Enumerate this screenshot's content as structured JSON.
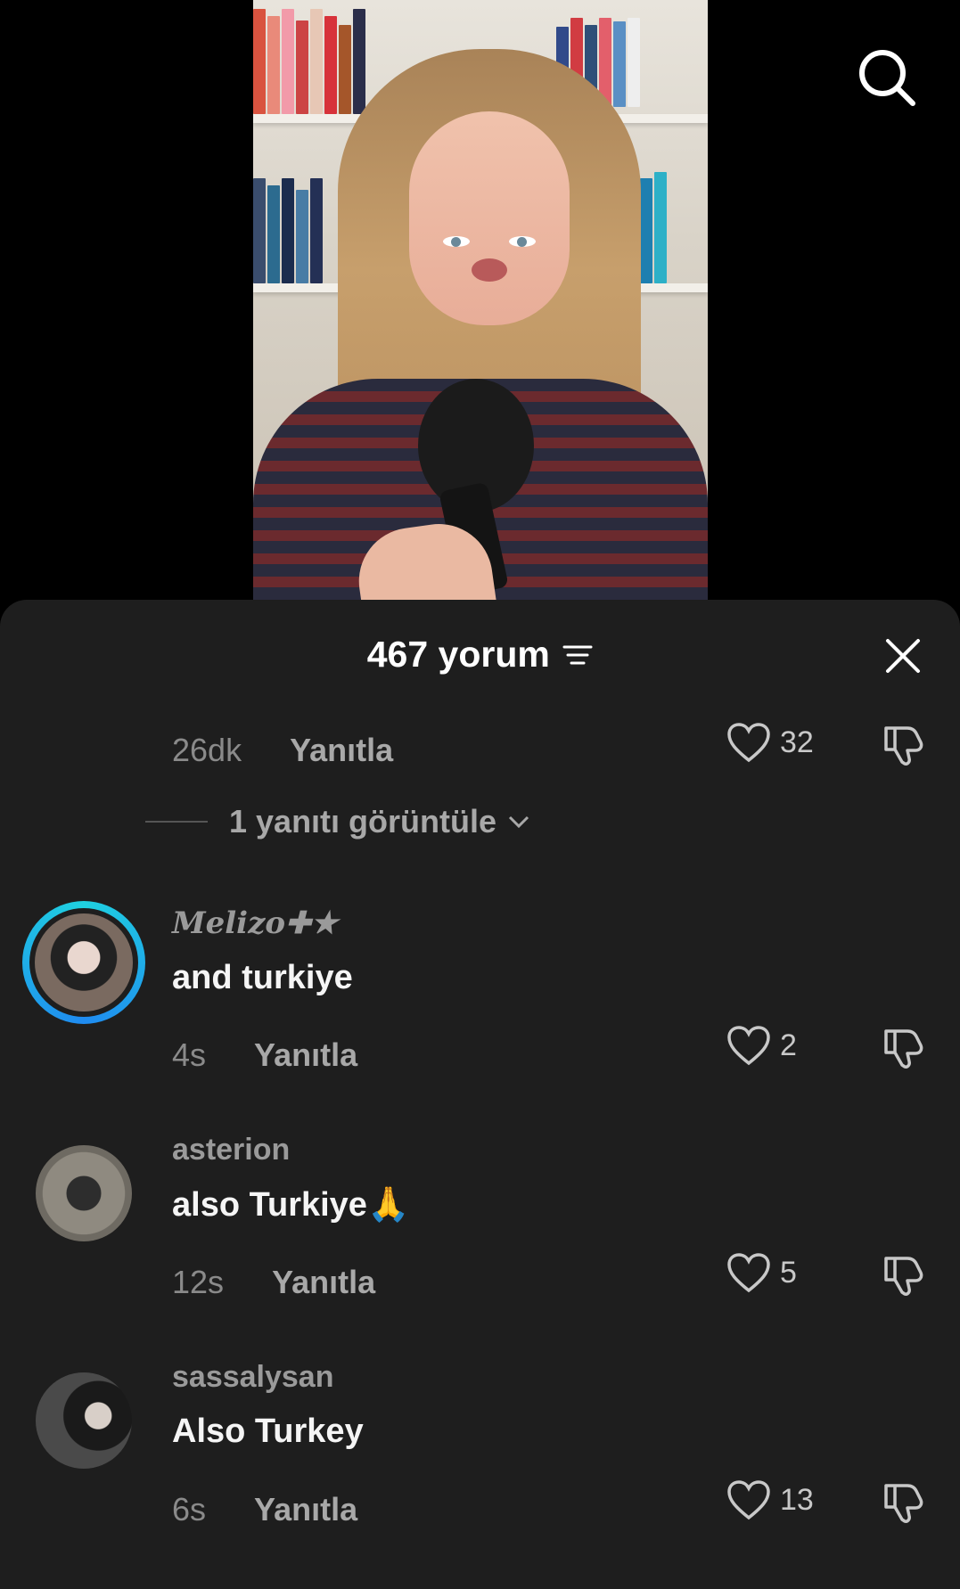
{
  "header": {
    "comment_count": "467 yorum"
  },
  "first_comment_tail": {
    "time": "26dk",
    "reply_label": "Yanıtla",
    "likes": "32"
  },
  "view_replies_label": "1 yanıtı görüntüle",
  "comments": [
    {
      "username": "Melizo✚★",
      "text": "and turkiye",
      "time": "4s",
      "reply_label": "Yanıtla",
      "likes": "2"
    },
    {
      "username": "asterion",
      "text": "also Turkiye🙏",
      "time": "12s",
      "reply_label": "Yanıtla",
      "likes": "5"
    },
    {
      "username": "sassalysan",
      "text": "Also Turkey",
      "time": "6s",
      "reply_label": "Yanıtla",
      "likes": "13"
    }
  ],
  "icons": {
    "search": "search-icon",
    "close": "close-icon",
    "filter": "filter-icon",
    "like": "heart-icon",
    "dislike": "thumbs-down-icon",
    "chevron": "chevron-down-icon"
  },
  "colors": {
    "sheet_bg": "#1e1e1e",
    "story_ring": "#1fb6e8"
  }
}
